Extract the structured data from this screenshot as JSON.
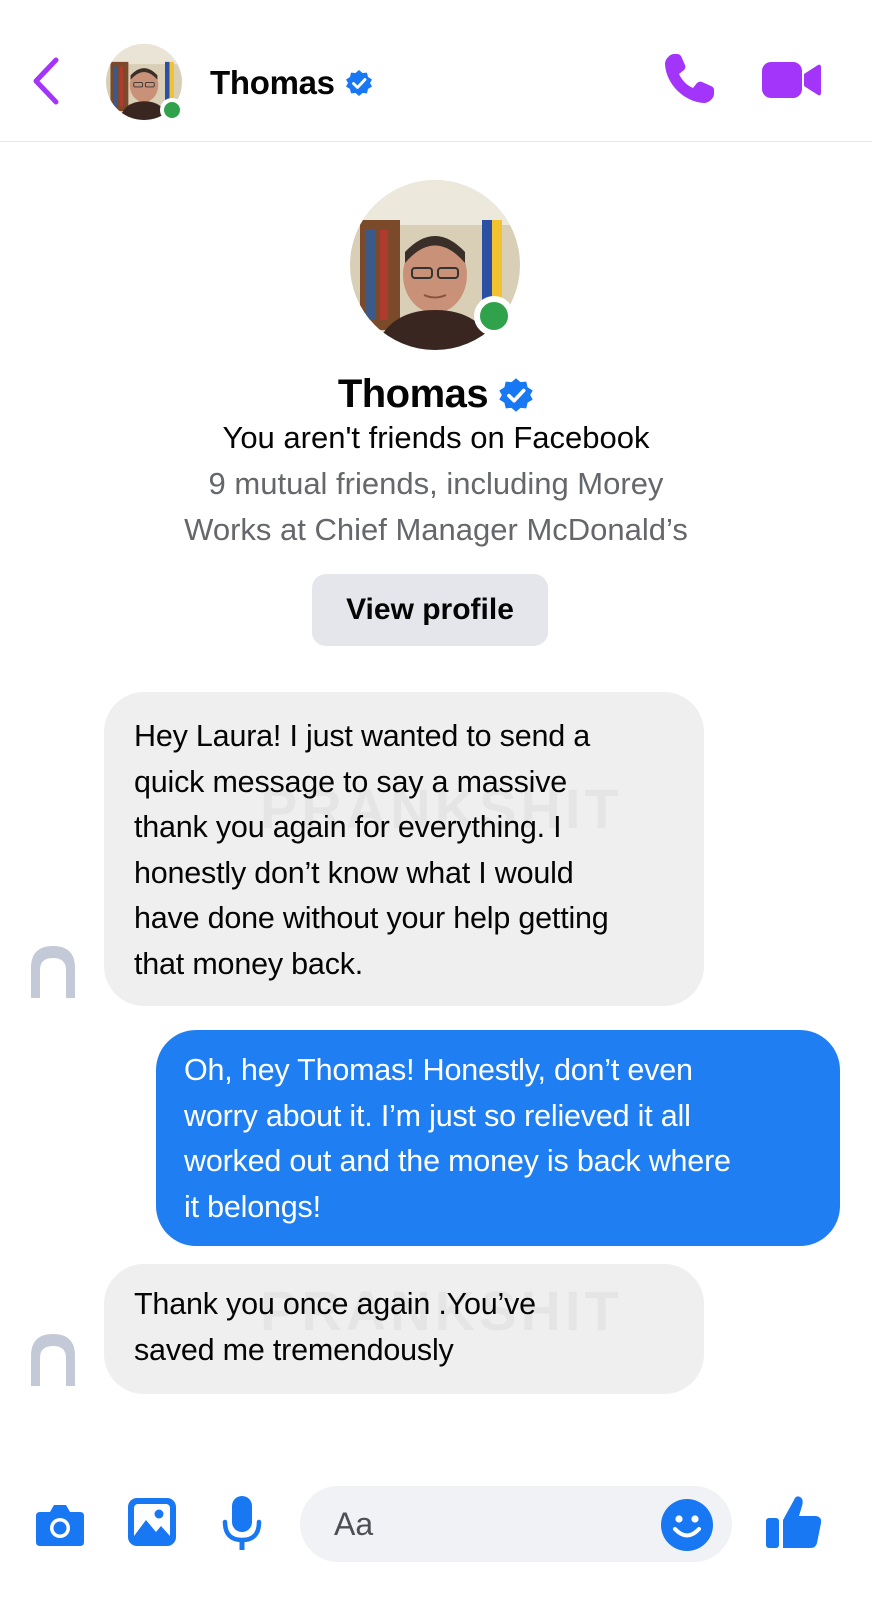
{
  "header": {
    "contact_name": "Thomas",
    "verified": true,
    "online": true
  },
  "profile": {
    "name": "Thomas",
    "friendship_status": "You aren't friends on Facebook",
    "mutual_friends": "9 mutual friends, including Morey",
    "work": "Works at Chief Manager McDonald’s",
    "view_profile_label": "View profile"
  },
  "messages": [
    {
      "direction": "incoming",
      "lines": [
        "Hey Laura! I just wanted to send a",
        "quick message to say a massive",
        "thank you again for everything. I",
        "honestly don’t know what I would",
        "have done without your help getting",
        "that money back."
      ]
    },
    {
      "direction": "outgoing",
      "lines": [
        "Oh, hey Thomas! Honestly, don’t even",
        "worry about it. I’m just so relieved it all",
        "worked out and the money is back where",
        "it belongs!"
      ]
    },
    {
      "direction": "incoming",
      "lines": [
        "Thank you once again .You’ve",
        "saved me tremendously"
      ]
    }
  ],
  "watermarks": [
    "PRANKSHIT",
    "PRANKSHIT"
  ],
  "composer": {
    "placeholder": "Aa"
  },
  "icons": {
    "back": "chevron-left-icon",
    "call": "phone-icon",
    "video": "video-camera-icon",
    "camera": "camera-icon",
    "gallery": "image-icon",
    "mic": "microphone-icon",
    "emoji": "smiley-icon",
    "like": "thumbs-up-icon"
  },
  "colors": {
    "accent_purple": "#a334fa",
    "messenger_blue": "#1f7ff2",
    "verified_blue": "#1877f2",
    "online_green": "#31a24c",
    "incoming_bubble": "#efefef"
  }
}
